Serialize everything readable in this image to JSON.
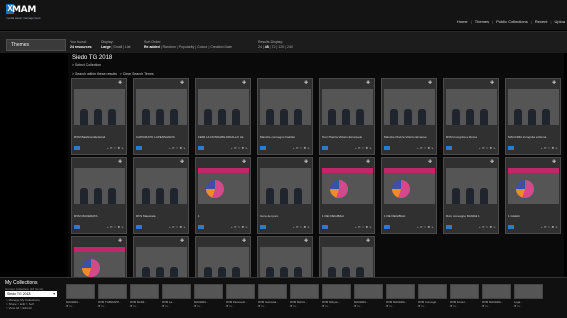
{
  "header": {
    "logo_letter": "X",
    "logo_word": "MAM",
    "logo_sub": "media asset management",
    "nav": [
      "Home",
      "Themes",
      "Public Collections",
      "Recent",
      "Uploa"
    ]
  },
  "toolbar": {
    "themes_label": "Themes",
    "you_found_label": "You found:",
    "you_found_value": "24 resources",
    "display_label": "Display:",
    "display_options": [
      "Large",
      "Small",
      "List"
    ],
    "sort_label": "Sort Order:",
    "sort_options": [
      "Re added",
      "Random",
      "Popularity",
      "Colour",
      "Creation Date"
    ],
    "results_label": "Results Display:",
    "results_options": [
      "24",
      "48",
      "72",
      "120",
      "240"
    ]
  },
  "main": {
    "title": "Siedo TG 2018",
    "select_collection": "> Select Collection",
    "search_within": "> Search within these results",
    "clear_search": "> Clear Search Terms"
  },
  "cards": [
    {
      "caption": "RVM Basilicat Elettorali",
      "scene": "sc-room"
    },
    {
      "caption": "CAPICRATO LAPENNANOS",
      "scene": "sc-street"
    },
    {
      "caption": "FEMI LA DONNARE DIDALLO LE",
      "scene": "sc-protest"
    },
    {
      "caption": "Manche convegno Falcide",
      "scene": "sc-crowd"
    },
    {
      "caption": "Tour Piazza Vittorio Emanuele",
      "scene": "sc-wall"
    },
    {
      "caption": "Manche Piazza Vittorio Emanue",
      "scene": "sc-wall"
    },
    {
      "caption": "RVM Incognita a Roma",
      "scene": "sc-rock"
    },
    {
      "caption": "MACCIMA Incognita a Roma",
      "scene": "sc-sky"
    },
    {
      "caption": "RVM MACERATA",
      "scene": "sc-man"
    },
    {
      "caption": "RVS Macerata",
      "scene": "sc-town"
    },
    {
      "caption": "1",
      "scene": "sc-pie"
    },
    {
      "caption": "Gore dei puro",
      "scene": "sc-red"
    },
    {
      "caption": "1 DEI DEGIBALI",
      "scene": "sc-pie"
    },
    {
      "caption": "1 DE DEGIBALI",
      "scene": "sc-pie"
    },
    {
      "caption": "Rvm convegno Mobilità 1",
      "scene": "sc-desk"
    },
    {
      "caption": "1 Gisletti",
      "scene": "sc-pie"
    },
    {
      "caption": "",
      "scene": "sc-pie"
    },
    {
      "caption": "",
      "scene": "sc-night"
    },
    {
      "caption": "",
      "scene": "sc-red"
    },
    {
      "caption": "",
      "scene": "sc-crowd"
    },
    {
      "caption": "",
      "scene": "sc-night"
    }
  ],
  "card_actions": "+ ✉ ☆ ✖ ↳",
  "collections": {
    "title": "My Collections",
    "subtitle": "Current Collection (16 items)",
    "selected": "Siedo TG 2018",
    "links": [
      "> Manage My Collections",
      "> Share  > Edit  > Self",
      "> View All  > Edit All"
    ],
    "items": [
      {
        "label": "MACERA...",
        "info": "✖ V+"
      },
      {
        "label": "RVM TGBRIAPP...",
        "info": "✖ V+"
      },
      {
        "label": "RVM Mobili...",
        "info": "✖ V+"
      },
      {
        "label": "RVM La...",
        "info": "✖ V+"
      },
      {
        "label": "MACERA...",
        "info": "✖ V+"
      },
      {
        "label": "RVM Parametri...",
        "info": "✖ V+"
      },
      {
        "label": "RVM Gazzetta...",
        "info": "✖ V+"
      },
      {
        "label": "RVM MACA...",
        "info": "✖ V+"
      },
      {
        "label": "RVM Mibyon...",
        "info": "✖ V+"
      },
      {
        "label": "MACERA...",
        "info": "✖ V+"
      },
      {
        "label": "RVM MACERA...",
        "info": "✖ V+"
      },
      {
        "label": "RVM Convegn...",
        "info": "✖ V+"
      },
      {
        "label": "RVM Fortez...",
        "info": "✖ V+"
      },
      {
        "label": "RVM MACERA...",
        "info": "✖ V+"
      },
      {
        "label": "Lega...",
        "info": "✖ V+"
      }
    ]
  }
}
